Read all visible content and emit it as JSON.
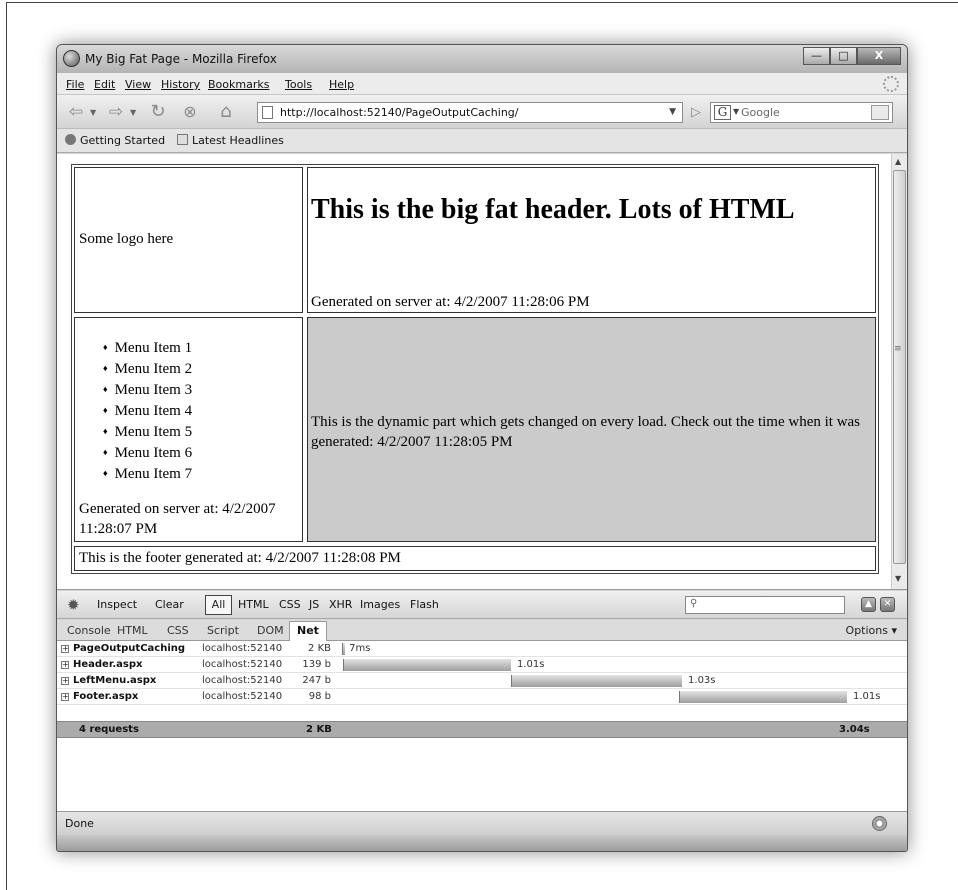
{
  "window": {
    "title": "My Big Fat Page - Mozilla Firefox"
  },
  "menubar": {
    "items": [
      "File",
      "Edit",
      "View",
      "History",
      "Bookmarks",
      "Tools",
      "Help"
    ]
  },
  "navbar": {
    "url": "http://localhost:52140/PageOutputCaching/",
    "search_engine_letter": "G",
    "search_placeholder": "Google"
  },
  "bookmarks": {
    "items": [
      "Getting Started",
      "Latest Headlines"
    ]
  },
  "page": {
    "logo_text": "Some logo here",
    "header_title": "This is the big fat header. Lots of HTML",
    "header_generated": "Generated on server at: 4/2/2007 11:28:06 PM",
    "menu_items": [
      "Menu Item 1",
      "Menu Item 2",
      "Menu Item 3",
      "Menu Item 4",
      "Menu Item 5",
      "Menu Item 6",
      "Menu Item 7"
    ],
    "left_generated": "Generated on server at: 4/2/2007 11:28:07 PM",
    "dynamic_text": "This is the dynamic part which gets changed on every load. Check out the time when it was generated: 4/2/2007 11:28:05 PM",
    "footer_text": "This is the footer generated at: 4/2/2007 11:28:08 PM"
  },
  "firebug": {
    "toolbar": {
      "inspect": "Inspect",
      "clear": "Clear",
      "filters": [
        "All",
        "HTML",
        "CSS",
        "JS",
        "XHR",
        "Images",
        "Flash"
      ],
      "active_filter": "All"
    },
    "tabs": [
      "Console",
      "HTML",
      "CSS",
      "Script",
      "DOM",
      "Net"
    ],
    "active_tab": "Net",
    "options_label": "Options ▾",
    "requests": [
      {
        "name": "PageOutputCaching",
        "domain": "localhost:52140",
        "size": "2 KB",
        "time": "7ms",
        "start_s": 0.0,
        "duration_s": 0.007
      },
      {
        "name": "Header.aspx",
        "domain": "localhost:52140",
        "size": "139 b",
        "time": "1.01s",
        "start_s": 0.007,
        "duration_s": 1.01
      },
      {
        "name": "LeftMenu.aspx",
        "domain": "localhost:52140",
        "size": "247 b",
        "time": "1.03s",
        "start_s": 1.017,
        "duration_s": 1.03
      },
      {
        "name": "Footer.aspx",
        "domain": "localhost:52140",
        "size": "98 b",
        "time": "1.01s",
        "start_s": 2.03,
        "duration_s": 1.01
      }
    ],
    "summary": {
      "requests": "4 requests",
      "size": "2 KB",
      "time": "3.04s",
      "total_s": 3.04
    }
  },
  "statusbar": {
    "text": "Done"
  }
}
